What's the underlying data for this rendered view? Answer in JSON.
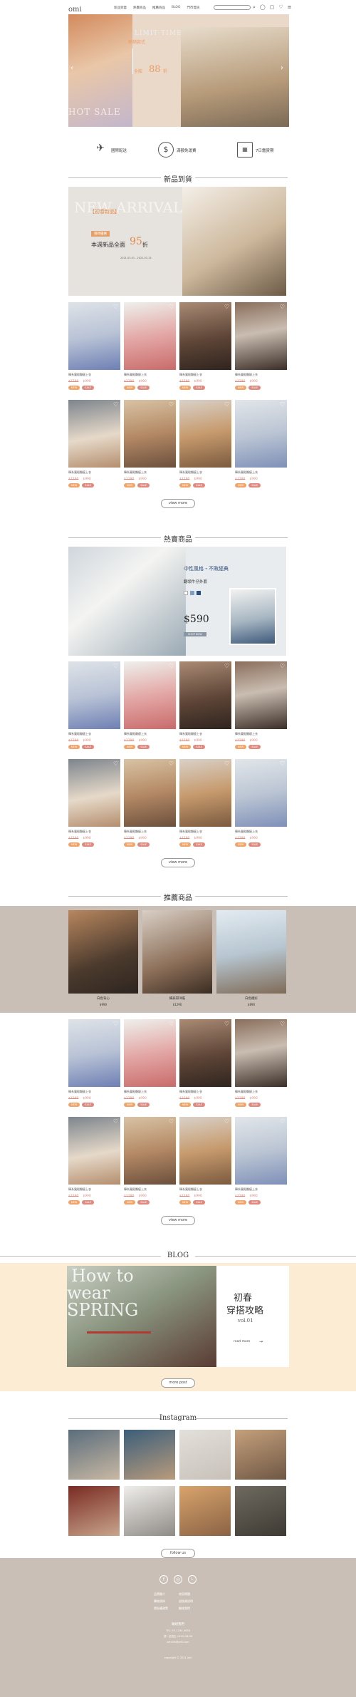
{
  "header": {
    "logo": "omi",
    "nav": [
      "新品到貨",
      "熱賣商品",
      "推薦商品",
      "BLOG",
      "門市資訊"
    ],
    "search_placeholder": "",
    "icons": [
      "search-icon",
      "user-icon",
      "bag-icon",
      "heart-icon",
      "menu-icon"
    ]
  },
  "hero": {
    "tag": "熱銷款式",
    "discount_prefix": "全館",
    "discount_value": "88",
    "discount_unit": "折",
    "en_top": "LIMIT TIME",
    "en_bottom": "HOT SALE",
    "arrow_left": "‹",
    "arrow_right": "›"
  },
  "features": [
    {
      "icon": "plane-icon",
      "label": "國際配送"
    },
    {
      "icon": "dollar-icon",
      "label": "滿額免運費"
    },
    {
      "icon": "calendar-icon",
      "label": "7日鑑賞期"
    }
  ],
  "new_arrivals": {
    "title": "新品到貨",
    "banner_tag": "【初春新品】",
    "banner_sub": "限時優惠",
    "banner_headline": "本週新品全面",
    "banner_num": "95",
    "banner_unit": "折",
    "banner_en": "NEW ARRIVAL",
    "banner_date": "2021.03.01 - 2021.03.15"
  },
  "hot": {
    "title": "熱賣商品",
    "banner_line1": "中性風格・不敗經典",
    "banner_line2": "翻領牛仔外套",
    "banner_price": "$590",
    "banner_btn": "SHOP NOW"
  },
  "recommend": {
    "title": "推薦商品",
    "items": [
      {
        "name": "白色背心",
        "price": "$990"
      },
      {
        "name": "細肩帶洋裝",
        "price": "$1290"
      },
      {
        "name": "白色襯衫",
        "price": "$890"
      }
    ]
  },
  "products": {
    "name": "韓系寬鬆顯瘦上衣",
    "old_price": "$1290",
    "new_price": "$990",
    "tag1": "NEW",
    "tag2": "SALE"
  },
  "view_more": "view more",
  "blog": {
    "title": "BLOG",
    "en1": "How to",
    "en2": "wear",
    "en3": "SPRING",
    "zh1": "初春",
    "zh2": "穿搭攻略",
    "vol": "vol.01",
    "read_more": "read more",
    "more_post": "more post"
  },
  "instagram": {
    "title": "Instagram",
    "follow": "follow us"
  },
  "footer": {
    "links": [
      "品牌簡介",
      "常見問題",
      "購物須知",
      "退換貨說明",
      "隱私權政策",
      "聯絡我們"
    ],
    "label": "聯絡我們",
    "phone": "TEL: 02-1234-5678",
    "hours": "週一至週五 10:00-18:00",
    "email": "service@omi.com",
    "copyright": "copyright © 2021 omi",
    "social": [
      "facebook-icon",
      "instagram-icon",
      "line-icon"
    ]
  },
  "colors": {
    "accent": "#e08a7f",
    "tag_orange": "#f0a46a",
    "beige": "#ead8c9",
    "cream": "#fbecd3",
    "taupe": "#c9bfb6"
  }
}
